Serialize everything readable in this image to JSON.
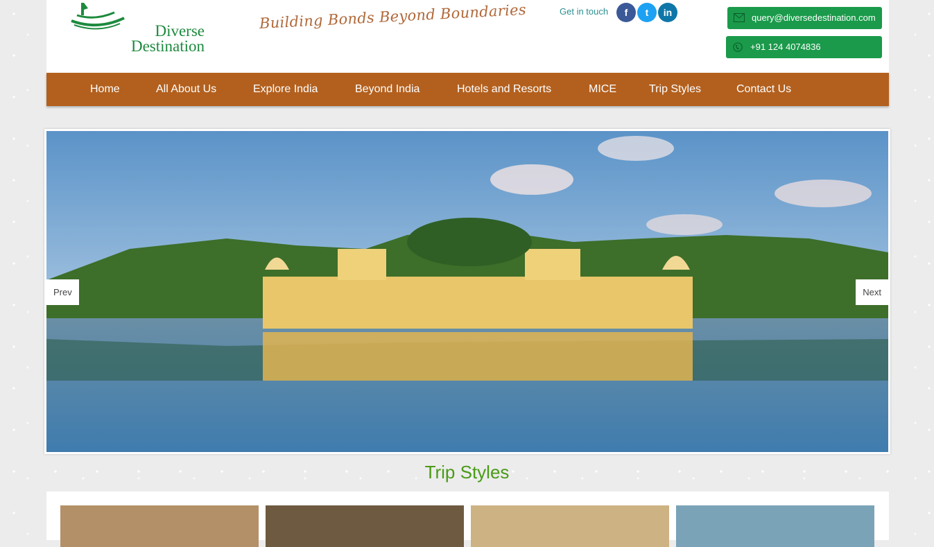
{
  "brand": {
    "line1": "Diverse",
    "line2": "Destination",
    "tagline": "Building Bonds Beyond Boundaries"
  },
  "contact": {
    "get_in_touch": "Get in touch",
    "email": "query@diversedestination.com",
    "phone": "+91 124 4074836",
    "social": [
      {
        "icon": "facebook-icon",
        "glyph": "f"
      },
      {
        "icon": "twitter-icon",
        "glyph": "t"
      },
      {
        "icon": "linkedin-icon",
        "glyph": "in"
      }
    ]
  },
  "nav": {
    "items": [
      {
        "label": "Home"
      },
      {
        "label": "All About Us"
      },
      {
        "label": "Explore India"
      },
      {
        "label": "Beyond India"
      },
      {
        "label": "Hotels and Resorts"
      },
      {
        "label": "MICE"
      },
      {
        "label": "Trip Styles"
      },
      {
        "label": "Contact Us"
      }
    ]
  },
  "slider": {
    "prev_label": "Prev",
    "next_label": "Next"
  },
  "trip_styles": {
    "title": "Trip Styles"
  },
  "colors": {
    "nav": "#b3601e",
    "brand_green": "#1d8a3e",
    "pill": "#1a9a4a",
    "title": "#4a9a17"
  }
}
